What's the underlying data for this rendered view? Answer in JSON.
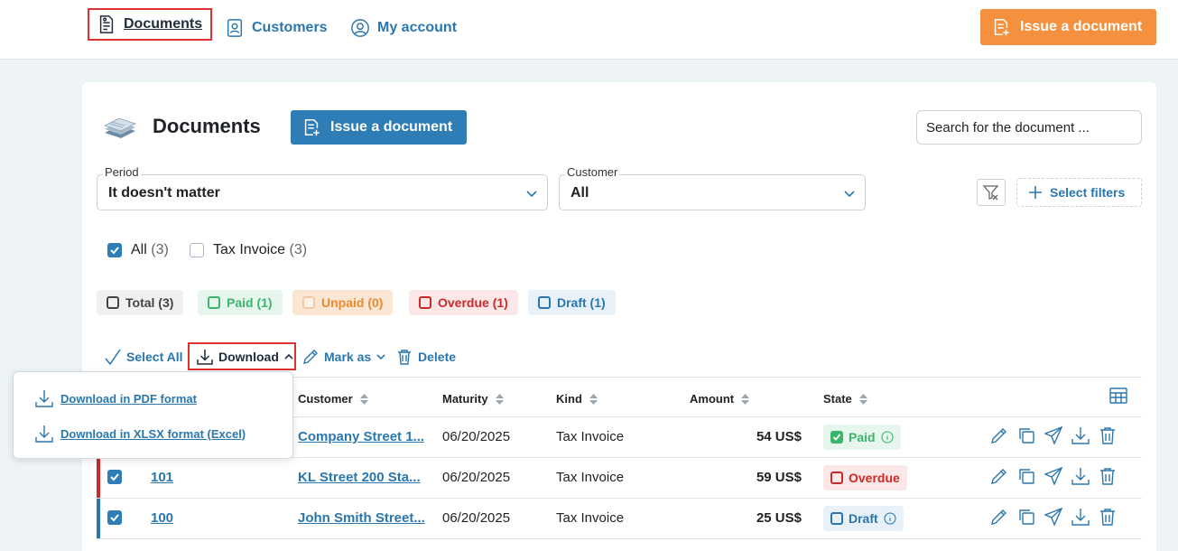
{
  "nav": {
    "documents": "Documents",
    "customers": "Customers",
    "my_account": "My account",
    "issue_button": "Issue a document"
  },
  "header": {
    "title": "Documents",
    "issue_button": "Issue a document",
    "search_placeholder": "Search for the document ..."
  },
  "filters": {
    "period_label": "Period",
    "period_value": "It doesn't matter",
    "customer_label": "Customer",
    "customer_value": "All",
    "select_filters": "Select filters"
  },
  "types": [
    {
      "label": "All",
      "count": "(3)",
      "checked": true
    },
    {
      "label": "Tax Invoice",
      "count": "(3)",
      "checked": false
    }
  ],
  "statuses": [
    {
      "label": "Total (3)",
      "color": "#444444",
      "bg": "#eef0f2"
    },
    {
      "label": "Paid (1)",
      "color": "#3bb56b",
      "bg": "#e6f6ec"
    },
    {
      "label": "Unpaid (0)",
      "color": "#e88a2e",
      "bg": "#fbe6d3"
    },
    {
      "label": "Overdue (1)",
      "color": "#cc2a2a",
      "bg": "#fbe7e7"
    },
    {
      "label": "Draft (1)",
      "color": "#2a77ae",
      "bg": "#e8f1f8"
    }
  ],
  "toolbar": {
    "select_all": "Select All",
    "download": "Download",
    "mark_as": "Mark as",
    "delete": "Delete"
  },
  "download_menu": {
    "pdf": "Download in PDF format",
    "xlsx": "Download in XLSX format (Excel)"
  },
  "table": {
    "headers": {
      "customer": "Customer",
      "maturity": "Maturity",
      "kind": "Kind",
      "amount": "Amount",
      "state": "State"
    },
    "rows": [
      {
        "number": "",
        "customer": "Company Street 1...",
        "maturity": "06/20/2025",
        "kind": "Tax Invoice",
        "amount": "54 US$",
        "state": "Paid",
        "accent": "#3bb56b"
      },
      {
        "number": "101",
        "customer": "KL Street 200 Sta...",
        "maturity": "06/20/2025",
        "kind": "Tax Invoice",
        "amount": "59 US$",
        "state": "Overdue",
        "accent": "#cc2a2a"
      },
      {
        "number": "100",
        "customer": "John Smith Street...",
        "maturity": "06/20/2025",
        "kind": "Tax Invoice",
        "amount": "25 US$",
        "state": "Draft",
        "accent": "#2a77ae"
      }
    ]
  },
  "colors": {
    "primary": "#2f7db6",
    "orange": "#f5913e",
    "highlight": "#e03030"
  }
}
